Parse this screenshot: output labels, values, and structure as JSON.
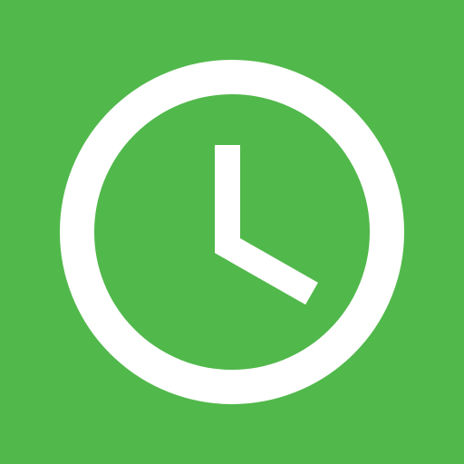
{
  "icon": {
    "name": "clock-icon",
    "background_color": "#51b84b",
    "foreground_color": "#ffffff"
  }
}
